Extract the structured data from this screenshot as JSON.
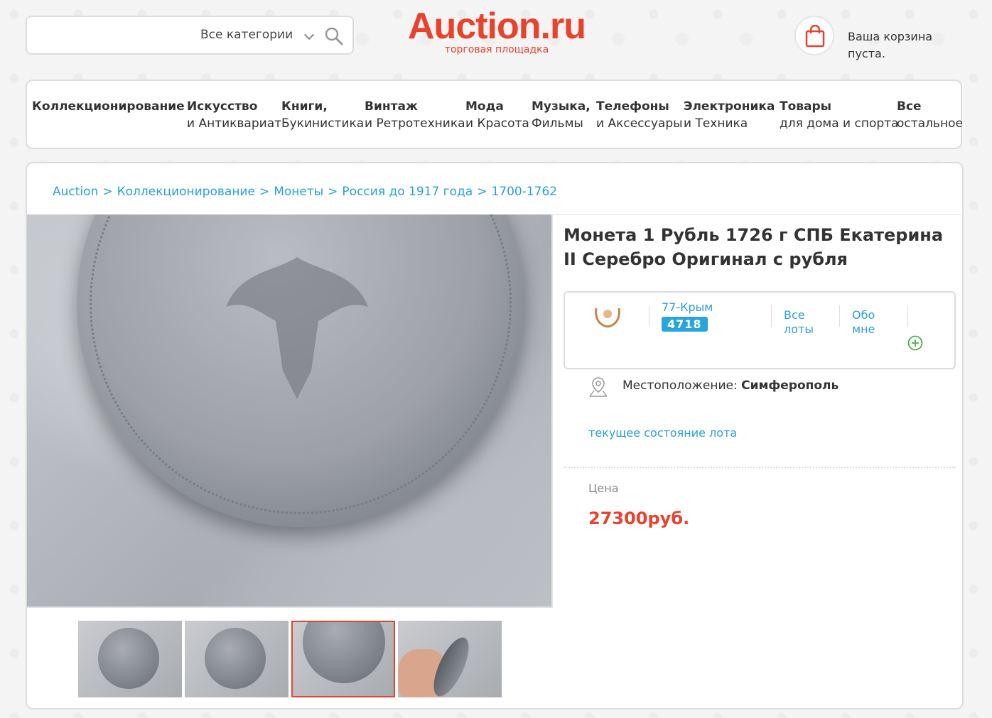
{
  "header": {
    "search": {
      "value": "",
      "placeholder": "",
      "category": "Все категории"
    },
    "logo": {
      "title": "Auction.ru",
      "subtitle": "торговая площадка"
    },
    "cart": {
      "text": "Ваша корзина пуста."
    }
  },
  "nav": [
    {
      "line1": "Коллекционирование",
      "line2": ""
    },
    {
      "line1": "Искусство",
      "line2": "и Антиквариат"
    },
    {
      "line1": "Книги,",
      "line2": "Букинистика"
    },
    {
      "line1": "Винтаж",
      "line2": "и Ретротехника"
    },
    {
      "line1": "Мода",
      "line2": "и Красота"
    },
    {
      "line1": "Музыка,",
      "line2": "Фильмы"
    },
    {
      "line1": "Телефоны",
      "line2": "и Аксессуары"
    },
    {
      "line1": "Электроника",
      "line2": "и Техника"
    },
    {
      "line1": "Товары",
      "line2": "для дома и спорта"
    },
    {
      "line1": "Все",
      "line2": "остальное"
    }
  ],
  "breadcrumb": [
    "Auction",
    "Коллекционирование",
    "Монеты",
    "Россия до 1917 года",
    "1700-1762"
  ],
  "breadcrumb_sep": ">",
  "lot": {
    "title": "Монета 1 Рубль 1726 г СПБ Екатерина II Серебро Оригинал с рубля",
    "thumbnails_count": 4,
    "active_thumbnail": 3
  },
  "seller": {
    "name": "77-Крым",
    "rating": "4718",
    "all_lots_line1": "Все",
    "all_lots_line2": "лоты",
    "about_line1": "Обо",
    "about_line2": "мне"
  },
  "location": {
    "label": "Местоположение:",
    "value": "Симферополь"
  },
  "state_link": "текущее состояние лота",
  "price": {
    "label": "Цена",
    "value": "27300руб."
  },
  "colors": {
    "brand": "#e8412c",
    "link": "#2a9fd8",
    "badge": "#2aa4dc"
  },
  "icons": [
    "search-icon",
    "chevron-down-icon",
    "shopping-bag-icon",
    "laurel-icon",
    "plus-icon",
    "location-pin-icon"
  ]
}
